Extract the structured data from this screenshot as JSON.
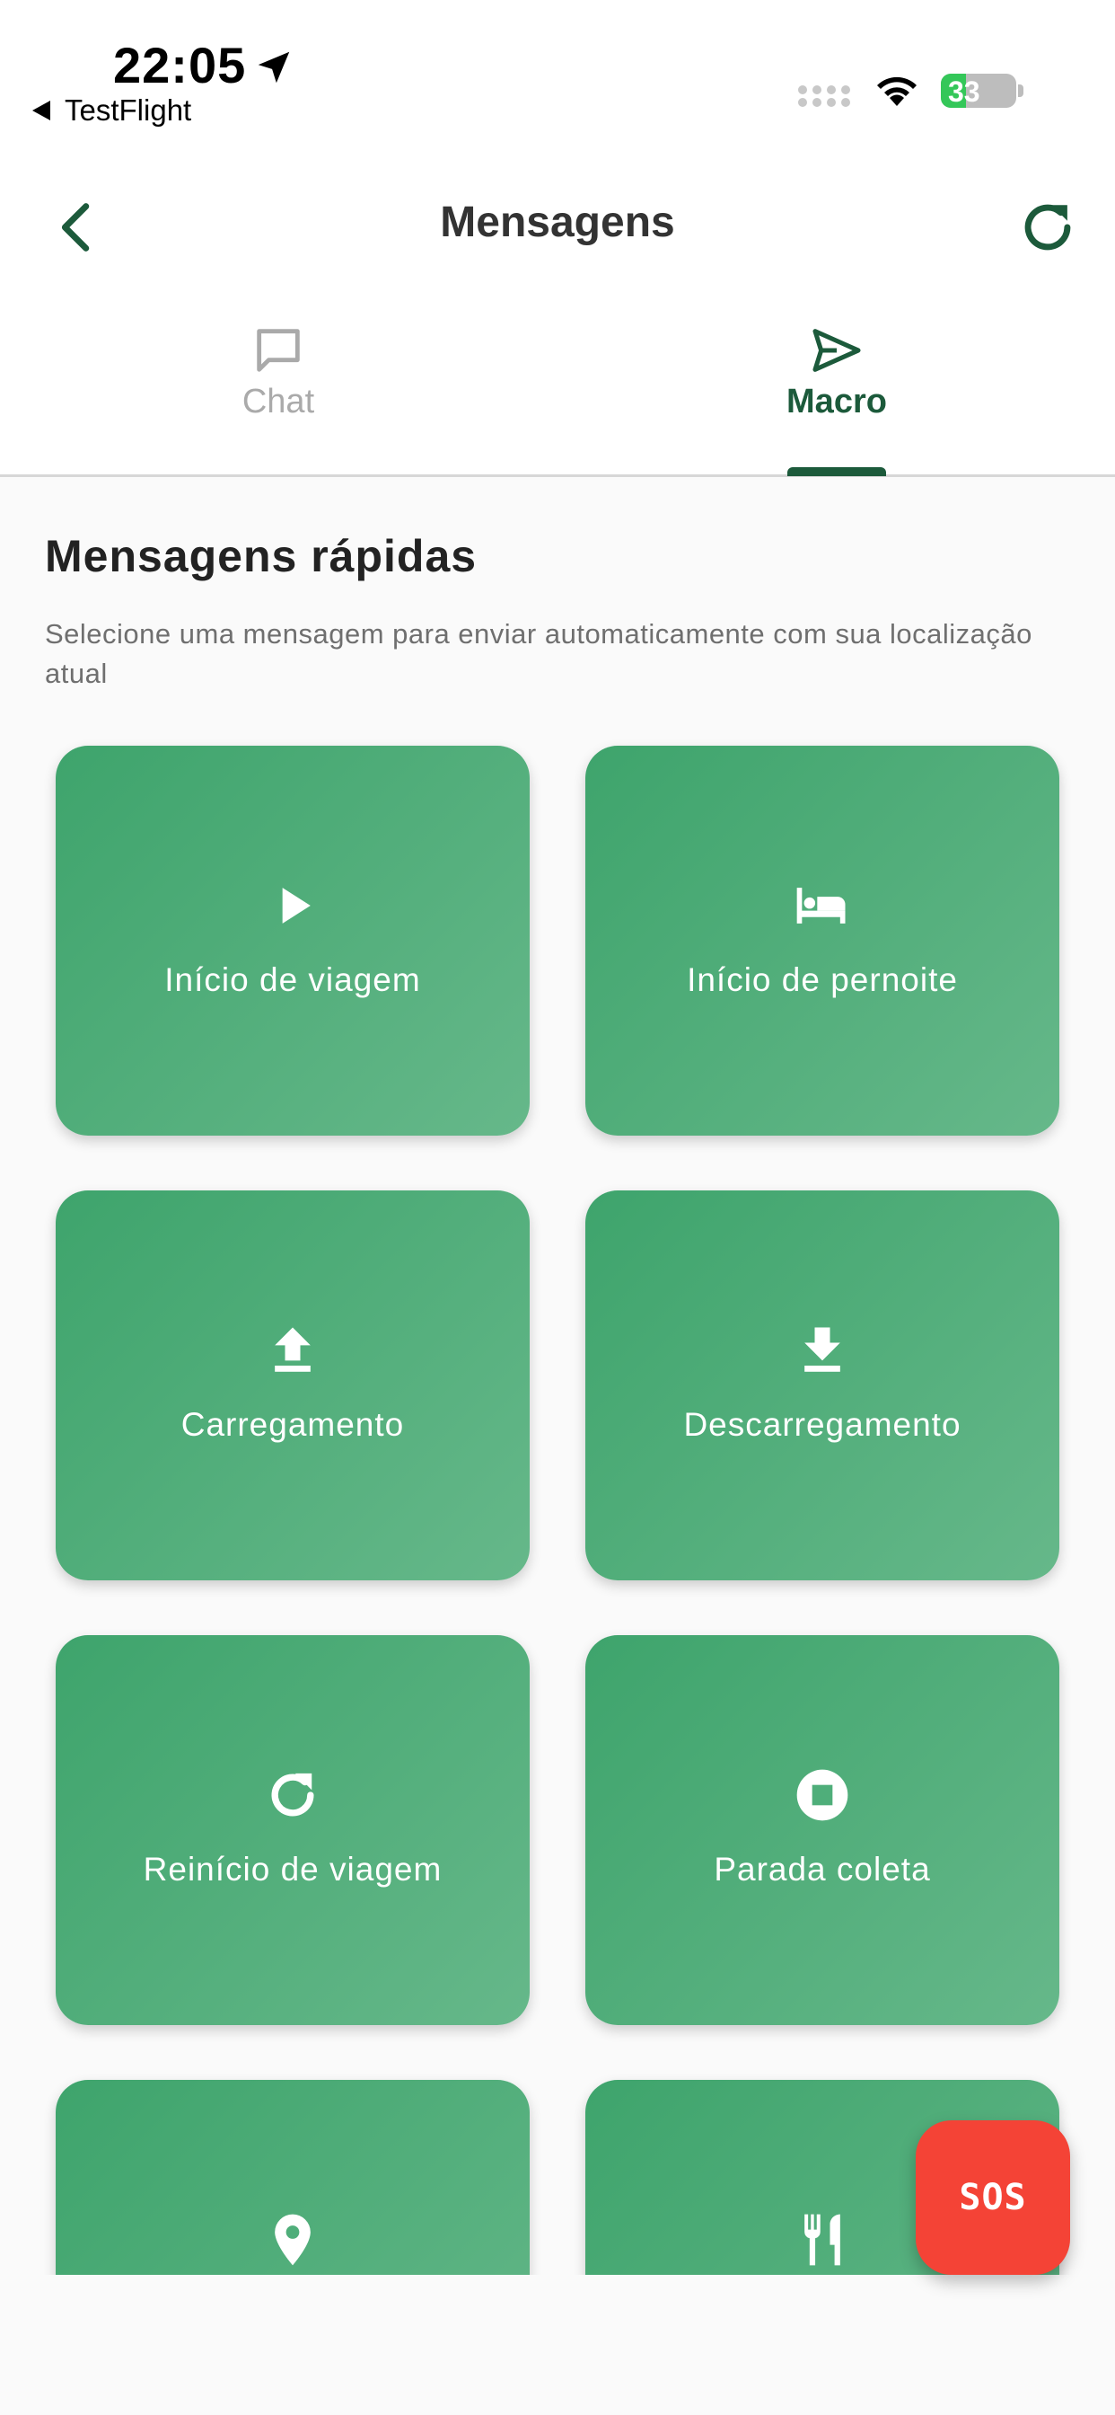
{
  "status_bar": {
    "time": "22:05",
    "back_app": "TestFlight",
    "battery_level": "33",
    "battery_percent": 33
  },
  "header": {
    "title": "Mensagens"
  },
  "tabs": [
    {
      "label": "Chat",
      "icon": "chat-bubble-icon",
      "active": false
    },
    {
      "label": "Macro",
      "icon": "send-icon",
      "active": true
    }
  ],
  "section": {
    "title": "Mensagens rápidas",
    "description": "Selecione uma mensagem para enviar automaticamente com sua localização atual"
  },
  "macros": [
    {
      "label": "Início de viagem",
      "icon": "play-icon"
    },
    {
      "label": "Início de pernoite",
      "icon": "bed-icon"
    },
    {
      "label": "Carregamento",
      "icon": "upload-icon"
    },
    {
      "label": "Descarregamento",
      "icon": "download-icon"
    },
    {
      "label": "Reinício de viagem",
      "icon": "restart-icon"
    },
    {
      "label": "Parada coleta",
      "icon": "stop-circle-icon"
    },
    {
      "label": "",
      "icon": "location-pin-icon"
    },
    {
      "label": "",
      "icon": "restaurant-icon"
    }
  ],
  "sos_button": {
    "label": "SOS"
  },
  "colors": {
    "primary_dark": "#1c5a3b",
    "card_gradient_start": "#3ea46c",
    "card_gradient_end": "#66b88a",
    "sos": "#f44336",
    "tab_inactive": "#aaaaaa"
  }
}
